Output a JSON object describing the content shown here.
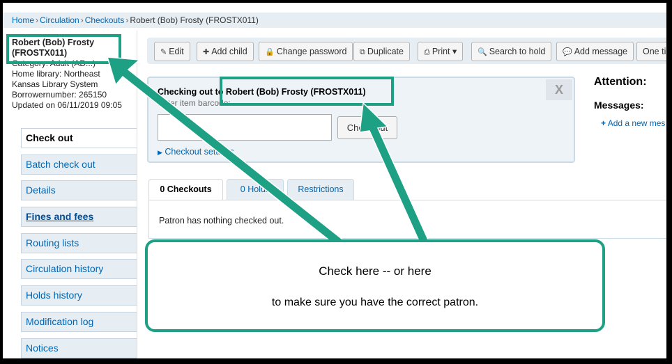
{
  "breadcrumb": {
    "home": "Home",
    "circulation": "Circulation",
    "checkouts": "Checkouts",
    "patron": "Robert (Bob) Frosty (FROSTX011)"
  },
  "patron": {
    "name_line1": "Robert (Bob) Frosty",
    "name_line2": "(FROSTX011)",
    "category": "Category: Adult (AD...)",
    "home_library": "Home library: Northeast",
    "library_system": "Kansas Library System",
    "borrowernumber": "Borrowernumber: 265150",
    "updated": "Updated on 06/11/2019 09:05"
  },
  "sidemenu": [
    "Check out",
    "Batch check out",
    "Details",
    "Fines and fees",
    "Routing lists",
    "Circulation history",
    "Holds history",
    "Modification log",
    "Notices"
  ],
  "toolbar": {
    "edit": "Edit",
    "add_child": "Add child",
    "change_password": "Change password",
    "duplicate": "Duplicate",
    "print": "Print",
    "search_to_hold": "Search to hold",
    "add_message": "Add message",
    "one_time": "One ti"
  },
  "checkout": {
    "title": "Checking out to Robert (Bob) Frosty (FROSTX011)",
    "subtitle": "Enter item barcode:",
    "button": "Check out",
    "settings": "Checkout settings",
    "close": "X"
  },
  "right": {
    "attention": "Attention:",
    "messages": "Messages:",
    "add_new_message": "Add a new mes"
  },
  "tabs": {
    "checkouts": "0 Checkouts",
    "holds": "0 Holds",
    "restrictions": "Restrictions"
  },
  "panel": {
    "message": "Patron has nothing checked out."
  },
  "callout": {
    "line1": "Check here  --  or here",
    "line2": "to make sure you have the correct patron."
  },
  "colors": {
    "annotation": "#1ea085",
    "link": "#0066b3"
  },
  "icons": [
    "pencil-icon",
    "plus-icon",
    "lock-icon",
    "copy-icon",
    "print-icon",
    "search-icon",
    "comment-icon",
    "caret-right-icon",
    "close-icon"
  ]
}
